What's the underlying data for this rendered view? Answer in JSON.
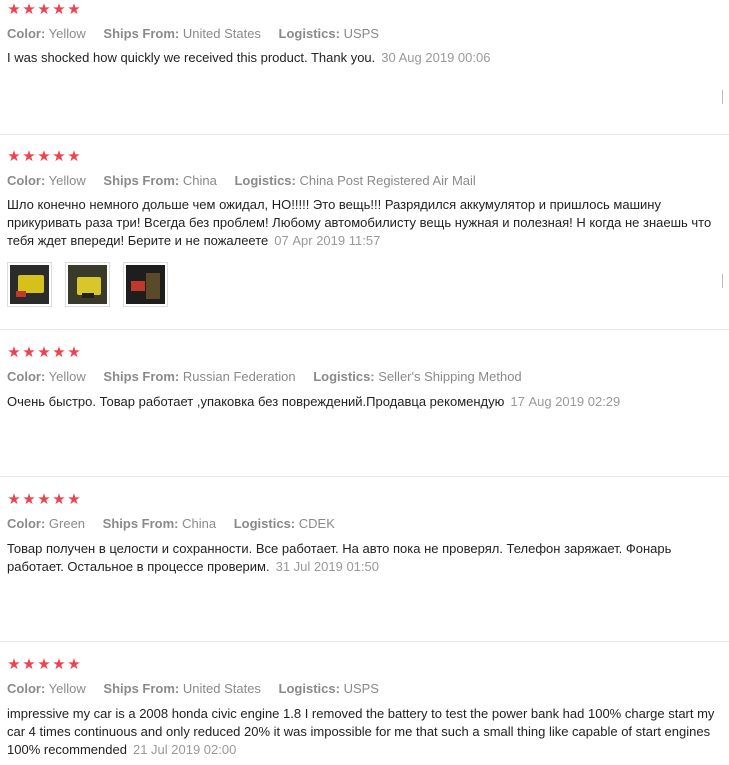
{
  "labels": {
    "color": "Color:",
    "ships_from": "Ships From:",
    "logistics": "Logistics:"
  },
  "star_color": "#f0414f",
  "reviews": [
    {
      "rating": 5,
      "color": "Yellow",
      "ships_from": "United States",
      "logistics": "USPS",
      "text": "I was shocked how quickly we received this product. Thank you.",
      "date": "30 Aug 2019 00:06"
    },
    {
      "rating": 5,
      "color": "Yellow",
      "ships_from": "China",
      "logistics": "China Post Registered Air Mail",
      "text": "Шло конечно немного дольше чем ожидал, НО!!!!! Это вещь!!! Разрядился аккумулятор и пришлось машину прикуривать раза три! Всегда без проблем! Любому автомобилисту вещь нужная и полезная! Н когда не знаешь что тебя ждет впереди! Берите и не пожалеете",
      "date": "07 Apr 2019 11:57",
      "photos": [
        "review-photo-1",
        "review-photo-2",
        "review-photo-3"
      ]
    },
    {
      "rating": 5,
      "color": "Yellow",
      "ships_from": "Russian Federation",
      "logistics": "Seller's Shipping Method",
      "text": "Очень быстро. Товар работает ,упаковка без повреждений.Продавца рекомендую",
      "date": "17 Aug 2019 02:29"
    },
    {
      "rating": 5,
      "color": "Green",
      "ships_from": "China",
      "logistics": "CDEK",
      "text": "Товар получен в целости и сохранности. Все работает. На авто пока не проверял. Телефон заряжает. Фонарь работает. Остальное в процессе проверим.",
      "date": "31 Jul 2019 01:50"
    },
    {
      "rating": 5,
      "color": "Yellow",
      "ships_from": "United States",
      "logistics": "USPS",
      "text": "impressive my car is a 2008 honda civic engine 1.8 I removed the battery to test the power bank had 100% charge start my car 4 times continuous and only reduced 20% it was impossible for me that such a small thing like capable of start engines 100% recommended",
      "date": "21 Jul 2019 02:00"
    }
  ]
}
